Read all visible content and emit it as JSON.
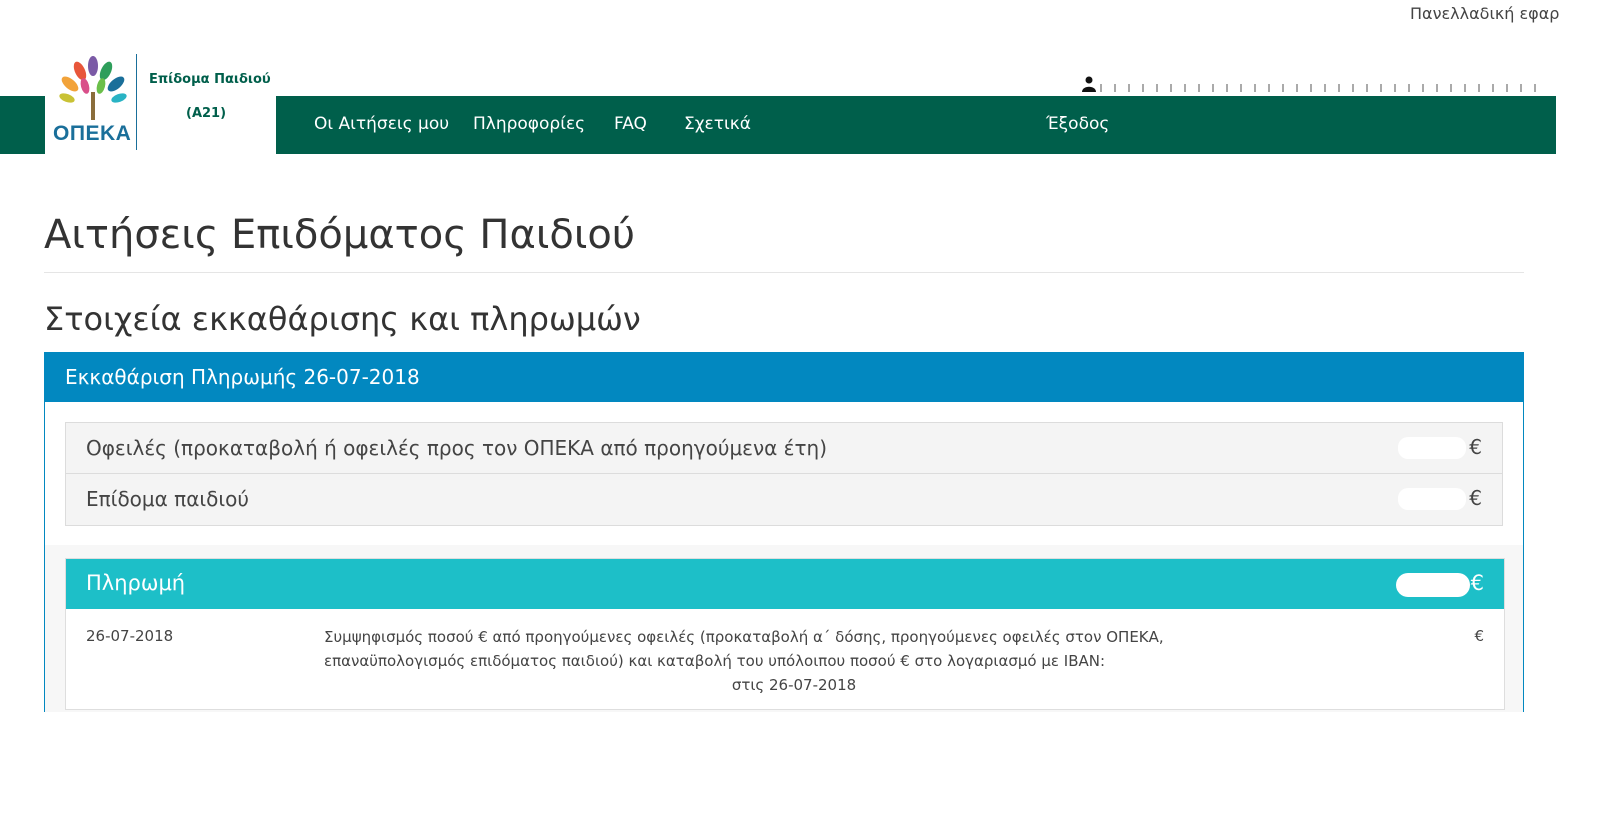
{
  "banner": {
    "text": "Πανελλαδική εφαρ"
  },
  "logo": {
    "brand": "ΟΠΕΚΑ",
    "title": "Επίδομα Παιδιού",
    "code": "(Α21)"
  },
  "nav": {
    "items": [
      {
        "label": "Οι Αιτήσεις μου"
      },
      {
        "label": "Πληροφορίες"
      },
      {
        "label": "FAQ"
      },
      {
        "label": "Σχετικά"
      }
    ],
    "logout": "Έξοδος"
  },
  "page": {
    "title": "Αιτήσεις Επιδόματος Παιδιού",
    "section_title": "Στοιχεία εκκαθάρισης και πληρωμών"
  },
  "panel": {
    "title": "Εκκαθάριση Πληρωμής 26-07-2018",
    "rows": [
      {
        "label": "Οφειλές (προκαταβολή ή οφειλές προς τον ΟΠΕΚΑ από προηγούμενα έτη)",
        "currency": "€"
      },
      {
        "label": "Επίδομα παιδιού",
        "currency": "€"
      }
    ]
  },
  "payment": {
    "title": "Πληρωμή",
    "currency": "€",
    "date": "26-07-2018",
    "desc_line1": "Συμψηφισμός ποσού        € από προηγούμενες οφειλές (προκαταβολή α΄ δόσης, προηγούμενες οφειλές στον ΟΠΕΚΑ,",
    "desc_line2": "επαναϋπολογισμός επιδόματος παιδιού) και καταβολή του υπόλοιπου ποσού        € στο λογαριασμό με IBAN:",
    "desc_line3": "στις 26-07-2018",
    "amount_currency": "€"
  },
  "colors": {
    "navbar": "#005f4b",
    "panel_header": "#0288c0",
    "payment_header": "#1dbfc8"
  }
}
